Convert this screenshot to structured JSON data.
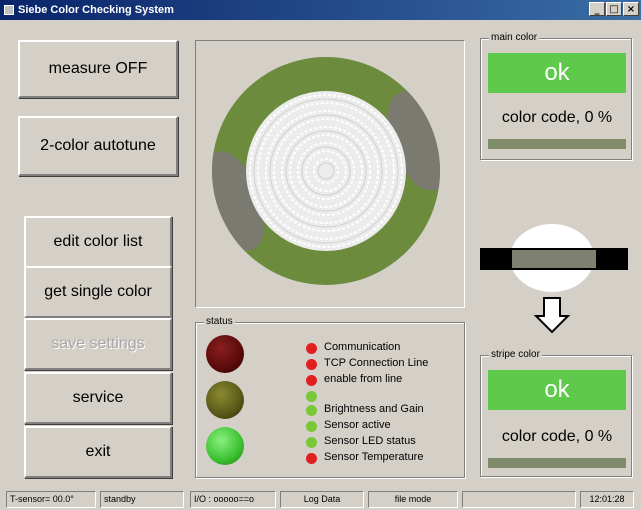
{
  "window": {
    "title": "Siebe Color Checking System",
    "controls": [
      "_",
      "□",
      "×"
    ]
  },
  "buttons": {
    "measure": "measure OFF",
    "autotune": "2-color autotune"
  },
  "menu": {
    "items": [
      {
        "label": "edit color list",
        "enabled": true
      },
      {
        "label": "get single color",
        "enabled": true
      },
      {
        "label": "save settings",
        "enabled": false
      },
      {
        "label": "service",
        "enabled": true
      },
      {
        "label": "exit",
        "enabled": true
      }
    ]
  },
  "main_color": {
    "legend": "main color",
    "result": "ok",
    "code_text": "color code, 0 %"
  },
  "stripe_color": {
    "legend": "stripe color",
    "result": "ok",
    "code_text": "color code, 0 %"
  },
  "status": {
    "legend": "status",
    "items": [
      {
        "label": "Communication",
        "state": "red"
      },
      {
        "label": "TCP Connection Line",
        "state": "red"
      },
      {
        "label": "enable from line",
        "state": "red"
      },
      {
        "label": "Brightness and Gain",
        "state": "green"
      },
      {
        "label": "Sensor active",
        "state": "green"
      },
      {
        "label": "Sensor LED status",
        "state": "green"
      },
      {
        "label": "Sensor Temperature",
        "state": "red"
      }
    ]
  },
  "statusbar": {
    "sensor_temp": "T-sensor= 00.0°",
    "mode_state": "standby",
    "io": "I/O : ooooo==o",
    "log": "Log Data",
    "file_mode": "file mode",
    "time": "12:01:28"
  },
  "colors": {
    "ok_green": "#5ec94a",
    "ring_green": "#6c8b3c",
    "led_red": "#e02020",
    "led_green": "#7ac83a"
  }
}
